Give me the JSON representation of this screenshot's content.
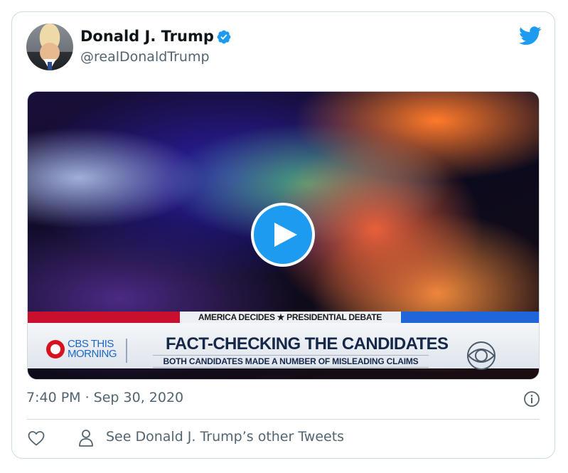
{
  "tweet": {
    "author_name": "Donald J. Trump",
    "handle": "@realDonaldTrump",
    "timestamp": "7:40 PM · Sep 30, 2020",
    "other_tweets_link": "See Donald J. Trump’s other Tweets"
  },
  "video": {
    "banner_top": "AMERICA DECIDES ★ PRESIDENTIAL DEBATE",
    "show_name": "CBS THIS MORNING",
    "headline": "FACT-CHECKING THE CANDIDATES",
    "subheadline": "BOTH CANDIDATES MADE A NUMBER OF MISLEADING CLAIMS"
  },
  "colors": {
    "twitter_blue": "#1d9bf0",
    "text_primary": "#0f1419",
    "text_secondary": "#536471",
    "border": "#cfd9de"
  },
  "icons": {
    "verified": "verified-badge-icon",
    "brand": "twitter-bird-icon",
    "play": "play-icon",
    "info": "info-icon",
    "like": "heart-icon",
    "profile": "person-icon"
  }
}
